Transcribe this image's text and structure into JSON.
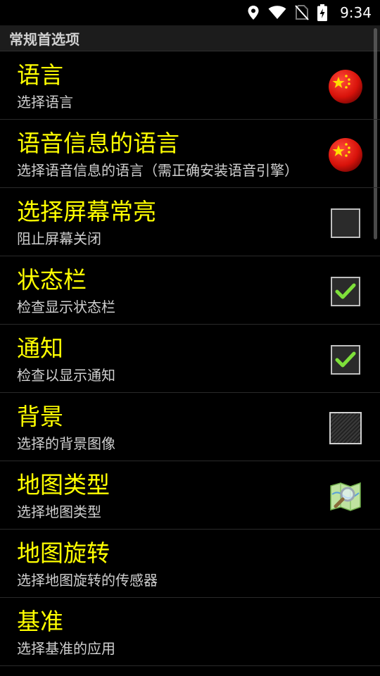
{
  "status_bar": {
    "time": "9:34"
  },
  "section": {
    "title": "常规首选项"
  },
  "items": [
    {
      "title": "语言",
      "subtitle": "选择语言",
      "widget": "china-flag-icon"
    },
    {
      "title": "语音信息的语言",
      "subtitle": "选择语音信息的语言（需正确安装语音引擎）",
      "widget": "china-flag-icon"
    },
    {
      "title": "选择屏幕常亮",
      "subtitle": "阻止屏幕关闭",
      "widget": "checkbox",
      "checked": false
    },
    {
      "title": "状态栏",
      "subtitle": "检查显示状态栏",
      "widget": "checkbox",
      "checked": true
    },
    {
      "title": "通知",
      "subtitle": "检查以显示通知",
      "widget": "checkbox",
      "checked": true
    },
    {
      "title": "背景",
      "subtitle": "选择的背景图像",
      "widget": "background-swatch-icon"
    },
    {
      "title": "地图类型",
      "subtitle": "选择地图类型",
      "widget": "map-search-icon"
    },
    {
      "title": "地图旋转",
      "subtitle": "选择地图旋转的传感器",
      "widget": "none"
    },
    {
      "title": "基准",
      "subtitle": "选择基准的应用",
      "widget": "none"
    }
  ],
  "colors": {
    "title": "#ffff00",
    "subtitle": "#cfcfcf",
    "header_bg": "#1c1c1c",
    "check": "#7ee03a"
  }
}
